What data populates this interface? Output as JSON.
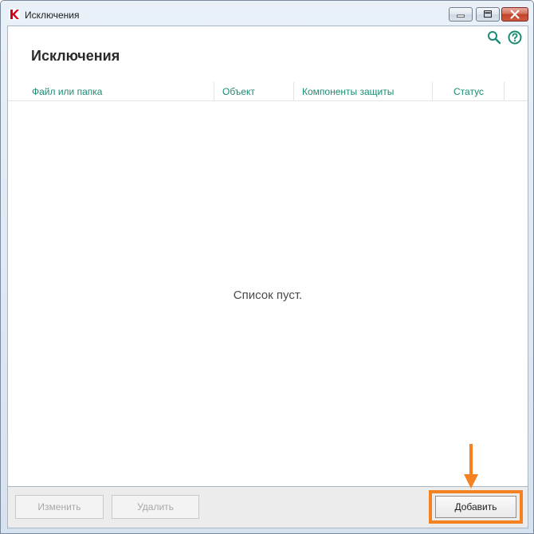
{
  "window": {
    "title": "Исключения"
  },
  "page": {
    "title": "Исключения",
    "empty_message": "Список пуст."
  },
  "table": {
    "columns": [
      "Файл или папка",
      "Объект",
      "Компоненты защиты",
      "Статус"
    ]
  },
  "footer": {
    "edit_label": "Изменить",
    "delete_label": "Удалить",
    "add_label": "Добавить"
  },
  "icons": {
    "search": "search-icon",
    "help": "help-icon"
  },
  "colors": {
    "accent": "#1b8b73",
    "highlight": "#f58220",
    "brand_red": "#d0021b"
  }
}
